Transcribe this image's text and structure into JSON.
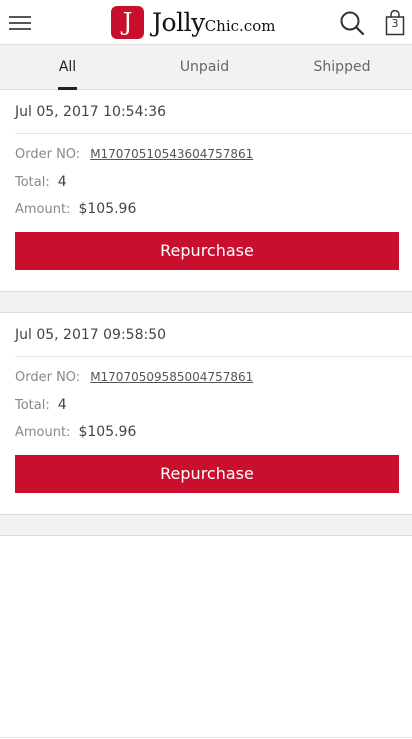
{
  "header": {
    "logo_letter": "J",
    "logo_name": "Jolly",
    "logo_suffix": "Chic.com",
    "bag_count": "3",
    "brand_color": "#c8102e"
  },
  "icons": {
    "menu": "hamburger-menu-icon",
    "search": "search-icon",
    "bag": "shopping-bag-icon"
  },
  "tabs": [
    {
      "label": "All",
      "active": true
    },
    {
      "label": "Unpaid",
      "active": false
    },
    {
      "label": "Shipped",
      "active": false
    }
  ],
  "orders": [
    {
      "date": "Jul 05, 2017 10:54:36",
      "order_no_label": "Order NO:",
      "order_no": "M17070510543604757861",
      "total_label": "Total:",
      "total": "4",
      "amount_label": "Amount:",
      "amount": "$105.96",
      "button_label": "Repurchase"
    },
    {
      "date": "Jul 05, 2017 09:58:50",
      "order_no_label": "Order NO:",
      "order_no": "M17070509585004757861",
      "total_label": "Total:",
      "total": "4",
      "amount_label": "Amount:",
      "amount": "$105.96",
      "button_label": "Repurchase"
    }
  ]
}
